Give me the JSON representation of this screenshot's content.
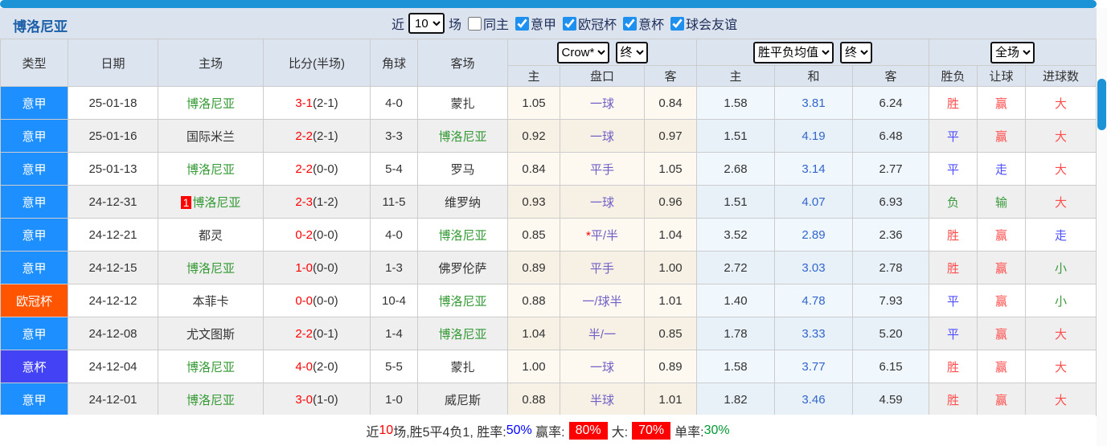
{
  "title": "博洛尼亚",
  "controls": {
    "recent_label": "近",
    "count_value": "10",
    "matches_label": "场",
    "same_home": {
      "label": "同主",
      "checked": false
    },
    "leagues": [
      {
        "label": "意甲",
        "checked": true
      },
      {
        "label": "欧冠杯",
        "checked": true
      },
      {
        "label": "意杯",
        "checked": true
      },
      {
        "label": "球会友谊",
        "checked": true
      }
    ]
  },
  "header": {
    "type": "类型",
    "date": "日期",
    "home": "主场",
    "score": "比分(半场)",
    "corners": "角球",
    "away": "客场",
    "odds_company_select": "Crow*",
    "odds_time_select": "终",
    "avg_name_select": "胜平负均值",
    "avg_time_select": "终",
    "scope_select": "全场",
    "odds_home": "主",
    "odds_handicap": "盘口",
    "odds_away": "客",
    "avg_home": "主",
    "avg_draw": "和",
    "avg_away": "客",
    "result": "胜负",
    "handicap_result": "让球",
    "goals": "进球数"
  },
  "tracked_team": "博洛尼亚",
  "colors": {
    "league": {
      "意甲": "#1d8fff",
      "欧冠杯": "#ff5500",
      "意杯": "#4343f5"
    },
    "outcome": {
      "胜": "#ff4d4d",
      "平": "#4d4dff",
      "负": "#3c9a3c",
      "赢": "#ff4d4d",
      "走": "#4d4dff",
      "输": "#3c9a3c",
      "大": "#ff4d4d",
      "小": "#3c9a3c"
    },
    "tracked_team": "#339933",
    "accent_blue": "#1c93d6"
  },
  "rows": [
    {
      "league": "意甲",
      "date": "25-01-18",
      "home_badge": "",
      "home": "博洛尼亚",
      "score": "3-1",
      "half": "(2-1)",
      "corners": "4-0",
      "away": "蒙扎",
      "odds_home": "1.05",
      "handicap": "一球",
      "odds_away": "0.84",
      "avg_home": "1.58",
      "avg_draw": "3.81",
      "avg_away": "6.24",
      "result": "胜",
      "handicap_result": "赢",
      "goals": "大"
    },
    {
      "league": "意甲",
      "date": "25-01-16",
      "home_badge": "",
      "home": "国际米兰",
      "score": "2-2",
      "half": "(2-1)",
      "corners": "3-3",
      "away": "博洛尼亚",
      "odds_home": "0.92",
      "handicap": "一球",
      "odds_away": "0.97",
      "avg_home": "1.51",
      "avg_draw": "4.19",
      "avg_away": "6.48",
      "result": "平",
      "handicap_result": "赢",
      "goals": "大"
    },
    {
      "league": "意甲",
      "date": "25-01-13",
      "home_badge": "",
      "home": "博洛尼亚",
      "score": "2-2",
      "half": "(0-0)",
      "corners": "5-4",
      "away": "罗马",
      "odds_home": "0.84",
      "handicap": "平手",
      "odds_away": "1.05",
      "avg_home": "2.68",
      "avg_draw": "3.14",
      "avg_away": "2.77",
      "result": "平",
      "handicap_result": "走",
      "goals": "大"
    },
    {
      "league": "意甲",
      "date": "24-12-31",
      "home_badge": "1",
      "home": "博洛尼亚",
      "score": "2-3",
      "half": "(1-2)",
      "corners": "11-5",
      "away": "维罗纳",
      "odds_home": "0.93",
      "handicap": "一球",
      "odds_away": "0.96",
      "avg_home": "1.51",
      "avg_draw": "4.07",
      "avg_away": "6.93",
      "result": "负",
      "handicap_result": "输",
      "goals": "大"
    },
    {
      "league": "意甲",
      "date": "24-12-21",
      "home_badge": "",
      "home": "都灵",
      "score": "0-2",
      "half": "(0-0)",
      "corners": "4-0",
      "away": "博洛尼亚",
      "odds_home": "0.85",
      "handicap": "*平/半",
      "odds_away": "1.04",
      "avg_home": "3.52",
      "avg_draw": "2.89",
      "avg_away": "2.36",
      "result": "胜",
      "handicap_result": "赢",
      "goals": "走"
    },
    {
      "league": "意甲",
      "date": "24-12-15",
      "home_badge": "",
      "home": "博洛尼亚",
      "score": "1-0",
      "half": "(0-0)",
      "corners": "1-3",
      "away": "佛罗伦萨",
      "odds_home": "0.89",
      "handicap": "平手",
      "odds_away": "1.00",
      "avg_home": "2.72",
      "avg_draw": "3.03",
      "avg_away": "2.78",
      "result": "胜",
      "handicap_result": "赢",
      "goals": "小"
    },
    {
      "league": "欧冠杯",
      "date": "24-12-12",
      "home_badge": "",
      "home": "本菲卡",
      "score": "0-0",
      "half": "(0-0)",
      "corners": "10-4",
      "away": "博洛尼亚",
      "odds_home": "0.88",
      "handicap": "一/球半",
      "odds_away": "1.01",
      "avg_home": "1.40",
      "avg_draw": "4.78",
      "avg_away": "7.93",
      "result": "平",
      "handicap_result": "赢",
      "goals": "小"
    },
    {
      "league": "意甲",
      "date": "24-12-08",
      "home_badge": "",
      "home": "尤文图斯",
      "score": "2-2",
      "half": "(0-1)",
      "corners": "1-4",
      "away": "博洛尼亚",
      "odds_home": "1.04",
      "handicap": "半/一",
      "odds_away": "0.85",
      "avg_home": "1.78",
      "avg_draw": "3.33",
      "avg_away": "5.20",
      "result": "平",
      "handicap_result": "赢",
      "goals": "大"
    },
    {
      "league": "意杯",
      "date": "24-12-04",
      "home_badge": "",
      "home": "博洛尼亚",
      "score": "4-0",
      "half": "(2-0)",
      "corners": "5-5",
      "away": "蒙扎",
      "odds_home": "1.00",
      "handicap": "一球",
      "odds_away": "0.89",
      "avg_home": "1.58",
      "avg_draw": "3.77",
      "avg_away": "6.15",
      "result": "胜",
      "handicap_result": "赢",
      "goals": "大"
    },
    {
      "league": "意甲",
      "date": "24-12-01",
      "home_badge": "",
      "home": "博洛尼亚",
      "score": "3-0",
      "half": "(1-0)",
      "corners": "1-0",
      "away": "威尼斯",
      "odds_home": "0.88",
      "handicap": "半球",
      "odds_away": "1.01",
      "avg_home": "1.82",
      "avg_draw": "3.46",
      "avg_away": "4.59",
      "result": "胜",
      "handicap_result": "赢",
      "goals": "大"
    }
  ],
  "footer": {
    "prefix": "近",
    "count": "10",
    "summary": "场,胜5平4负1, ",
    "win_rate_label": "胜率:",
    "win_rate": "50%",
    "handicap_rate_label": "赢率:",
    "handicap_rate": "80%",
    "big_label": "大:",
    "big_rate": "70%",
    "single_rate_label": "单率:",
    "single_rate": "30%"
  }
}
